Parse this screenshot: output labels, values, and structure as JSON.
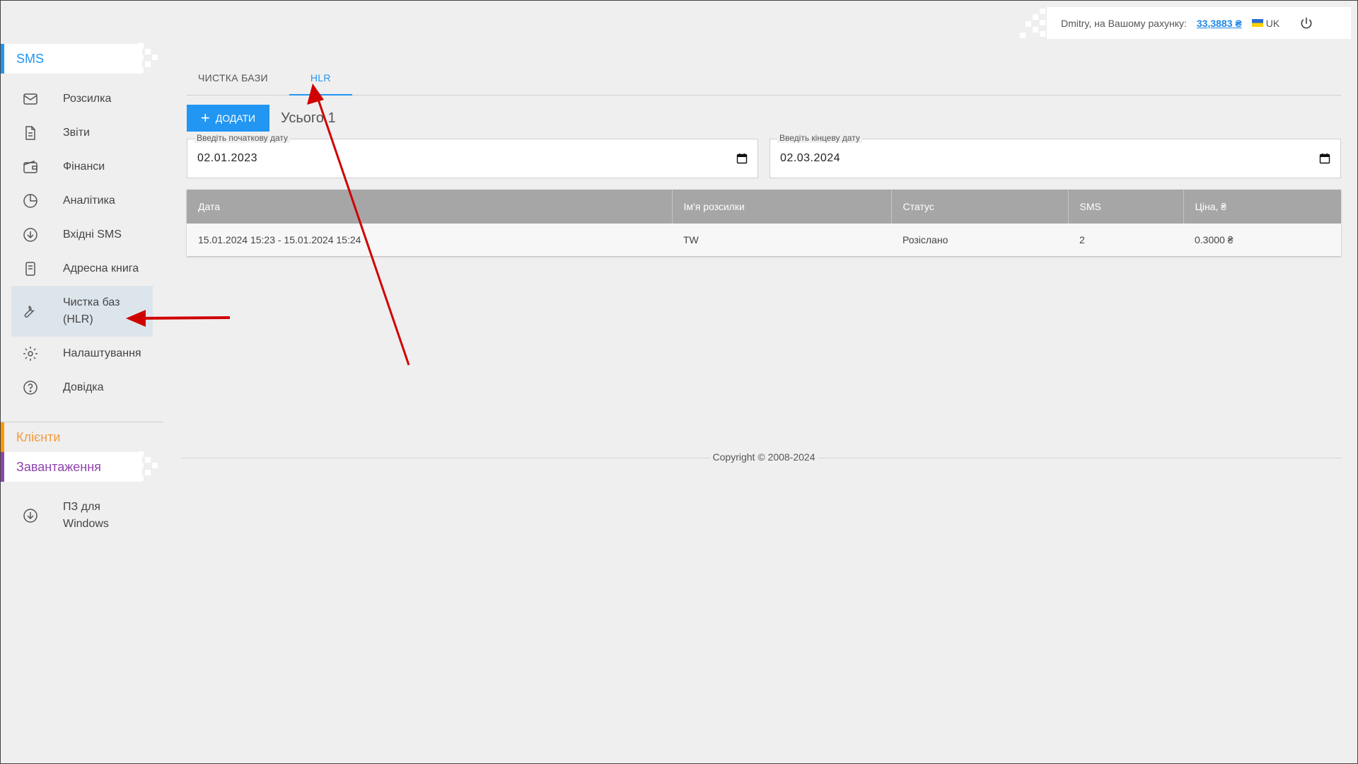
{
  "topbar": {
    "greeting": "Dmitry, на Вашому рахунку:",
    "balance": "33,3883 ₴",
    "lang": "UK"
  },
  "sidebar": {
    "section_sms": "SMS",
    "items": [
      {
        "label": "Розсилка",
        "icon": "mail-icon"
      },
      {
        "label": "Звіти",
        "icon": "document-icon"
      },
      {
        "label": "Фінанси",
        "icon": "wallet-icon"
      },
      {
        "label": "Аналітика",
        "icon": "pie-chart-icon"
      },
      {
        "label": "Вхідні SMS",
        "icon": "download-circle-icon"
      },
      {
        "label": "Адресна книга",
        "icon": "address-book-icon"
      },
      {
        "label": "Чистка баз",
        "label2": "(HLR)",
        "icon": "wrench-icon"
      },
      {
        "label": "Налаштування",
        "icon": "gear-icon"
      },
      {
        "label": "Довідка",
        "icon": "help-icon"
      }
    ],
    "section_clients": "Клієнти",
    "section_downloads": "Завантаження",
    "download_item": {
      "label": "ПЗ для",
      "label2": "Windows",
      "icon": "download-circle-icon"
    }
  },
  "tabs": [
    {
      "label": "Чистка бази"
    },
    {
      "label": "HLR"
    }
  ],
  "toolbar": {
    "add_label": "Додати",
    "total": "Усього 1"
  },
  "filters": {
    "start_label": "Введіть початкову дату",
    "start_value": "02.01.2023",
    "end_label": "Введіть кінцеву дату",
    "end_value": "02.03.2024"
  },
  "table": {
    "columns": [
      "Дата",
      "Ім'я розсилки",
      "Статус",
      "SMS",
      "Ціна, ₴"
    ],
    "rows": [
      [
        "15.01.2024 15:23 - 15.01.2024 15:24",
        "TW",
        "Розіслано",
        "2",
        "0.3000 ₴"
      ]
    ]
  },
  "footer": {
    "copyright": "Copyright © 2008-2024"
  },
  "colors": {
    "accent_sms": "#2196f3",
    "accent_clients": "#ff9800",
    "accent_downloads": "#8e44ad",
    "annotation": "#d00000"
  }
}
